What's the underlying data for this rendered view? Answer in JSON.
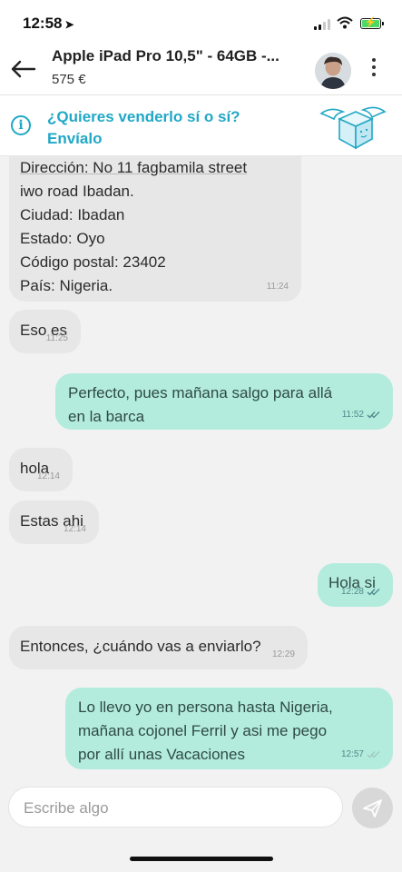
{
  "status_bar": {
    "time": "12:58",
    "location_arrow": "➤"
  },
  "header": {
    "title": "Apple iPad Pro 10,5\" - 64GB -...",
    "price": "575 €"
  },
  "banner": {
    "text": "¿Quieres venderlo sí o sí? Envíalo"
  },
  "messages": [
    {
      "dir": "in",
      "lines": [
        "Dirección: No 11 fagbamila street",
        "iwo road Ibadan.",
        "Ciudad: Ibadan",
        "Estado: Oyo",
        "Código postal: 23402",
        "País: Nigeria."
      ],
      "time": "11:24"
    },
    {
      "dir": "in",
      "lines": [
        "Eso es"
      ],
      "time": "11:25"
    },
    {
      "dir": "out",
      "lines": [
        "Perfecto, pues mañana salgo para allá",
        "en la barca"
      ],
      "time": "11:52"
    },
    {
      "dir": "in",
      "lines": [
        "hola"
      ],
      "time": "12:14"
    },
    {
      "dir": "in",
      "lines": [
        "Estas ahi"
      ],
      "time": "12:14"
    },
    {
      "dir": "out",
      "lines": [
        "Hola si"
      ],
      "time": "12:28"
    },
    {
      "dir": "in",
      "lines": [
        "Entonces, ¿cuándo vas a enviarlo?"
      ],
      "time": "12:29"
    },
    {
      "dir": "out",
      "lines": [
        "Lo llevo yo en persona hasta Nigeria,",
        "mañana cojonel Ferril y asi me pego",
        "por allí unas Vacaciones"
      ],
      "time": "12:57"
    }
  ],
  "composer": {
    "placeholder": "Escribe algo"
  },
  "icons": {
    "back": "arrow-left-icon",
    "more": "kebab-menu-icon",
    "info": "info-icon",
    "shipping": "flying-box-icon",
    "send": "paper-plane-icon",
    "read": "double-check-icon"
  },
  "colors": {
    "accent": "#21a8c6",
    "incoming": "#e7e7e7",
    "outgoing": "#b3ecdd",
    "read_ticks": "#4e8a8a"
  }
}
